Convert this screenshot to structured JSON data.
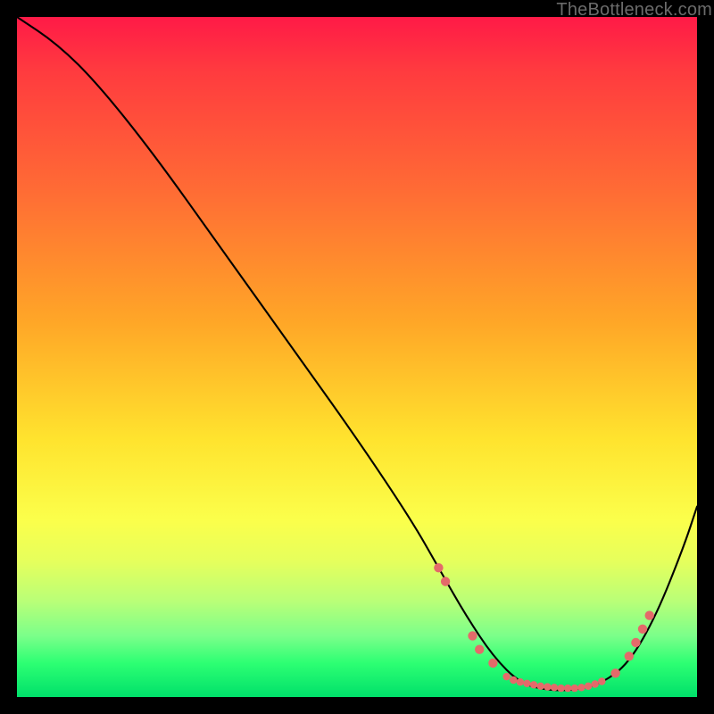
{
  "watermark": "TheBottleneck.com",
  "colors": {
    "curve": "#000000",
    "marker": "#e46a6a",
    "background_black": "#000000"
  },
  "chart_data": {
    "type": "line",
    "title": "",
    "xlabel": "",
    "ylabel": "",
    "xlim": [
      0,
      100
    ],
    "ylim": [
      0,
      100
    ],
    "grid": false,
    "legend": false,
    "description": "Bottleneck curve: high values on the left descending steeply to a flat near-zero valley around x≈73–88, then rising toward the right edge. Discrete salmon-colored markers trace the valley region.",
    "series": [
      {
        "name": "bottleneck-curve",
        "x": [
          0,
          6,
          12,
          20,
          30,
          40,
          50,
          58,
          62,
          66,
          70,
          74,
          78,
          82,
          86,
          90,
          94,
          98,
          100
        ],
        "y": [
          100,
          96,
          90,
          80,
          66,
          52,
          38,
          26,
          19,
          12,
          6,
          2,
          1,
          1,
          2,
          5,
          12,
          22,
          28
        ]
      }
    ],
    "markers": {
      "name": "valley-markers",
      "points": [
        {
          "x": 62,
          "y": 19
        },
        {
          "x": 63,
          "y": 17
        },
        {
          "x": 67,
          "y": 9
        },
        {
          "x": 68,
          "y": 7
        },
        {
          "x": 70,
          "y": 5
        },
        {
          "x": 72,
          "y": 3
        },
        {
          "x": 73,
          "y": 2.5
        },
        {
          "x": 74,
          "y": 2.2
        },
        {
          "x": 75,
          "y": 2
        },
        {
          "x": 76,
          "y": 1.8
        },
        {
          "x": 77,
          "y": 1.6
        },
        {
          "x": 78,
          "y": 1.5
        },
        {
          "x": 79,
          "y": 1.4
        },
        {
          "x": 80,
          "y": 1.3
        },
        {
          "x": 81,
          "y": 1.3
        },
        {
          "x": 82,
          "y": 1.3
        },
        {
          "x": 83,
          "y": 1.4
        },
        {
          "x": 84,
          "y": 1.6
        },
        {
          "x": 85,
          "y": 1.9
        },
        {
          "x": 86,
          "y": 2.3
        },
        {
          "x": 88,
          "y": 3.5
        },
        {
          "x": 90,
          "y": 6
        },
        {
          "x": 91,
          "y": 8
        },
        {
          "x": 92,
          "y": 10
        },
        {
          "x": 93,
          "y": 12
        }
      ]
    }
  }
}
